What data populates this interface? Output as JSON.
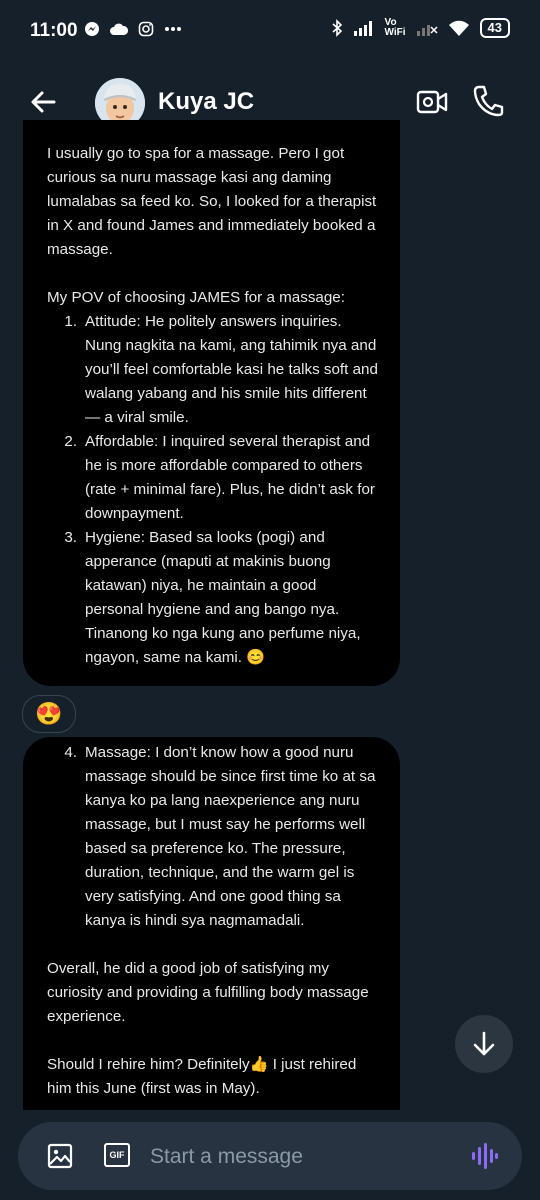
{
  "status": {
    "time": "11:00",
    "vowifi": "Vo\nWiFi",
    "battery": "43"
  },
  "header": {
    "contact_name": "Kuya JC"
  },
  "messages": {
    "bubble1": {
      "intro": "I usually go to spa for a massage. Pero I got curious sa nuru massage kasi ang daming lumalabas sa feed ko. So, I looked for a therapist in X and found James and immediately booked a massage.",
      "pov_heading": "My POV of choosing JAMES for a massage:",
      "list": [
        {
          "num": "1.",
          "text": "Attitude: He politely answers inquiries. Nung nagkita na kami, ang tahimik nya and you’ll feel comfortable kasi he talks soft and walang yabang and his smile hits different — a viral smile."
        },
        {
          "num": "2.",
          "text": "Affordable: I inquired several therapist and he is more affordable compared to others (rate + minimal fare). Plus, he didn’t ask for downpayment."
        },
        {
          "num": "3.",
          "text": "Hygiene: Based sa looks (pogi) and apperance (maputi at makinis buong katawan) niya, he maintain a good personal hygiene and ang bango nya. Tinanong ko nga kung ano perfume niya, ngayon, same na kami. 😊"
        }
      ]
    },
    "reaction": "😍",
    "bubble2": {
      "list": [
        {
          "num": "4.",
          "text": "Massage: I don’t know how a good nuru massage should be since first time ko at sa kanya ko pa lang naexperience ang nuru massage, but I must say he performs well based sa preference ko. The pressure, duration, technique, and the warm gel is very satisfying. And one good thing sa kanya is hindi sya nagmamadali."
        }
      ],
      "overall": "Overall, he did a good job of satisfying my curiosity and providing a fulfilling body massage experience.",
      "closing": "Should I rehire him? Definitely👍 I just rehired him this June (first was in May)."
    }
  },
  "composer": {
    "placeholder": "Start a message",
    "gif_label": "GIF"
  },
  "colors": {
    "background": "#15202b",
    "bubble": "#000000",
    "composer": "#273340",
    "voice_accent": "#8b6cf6"
  }
}
